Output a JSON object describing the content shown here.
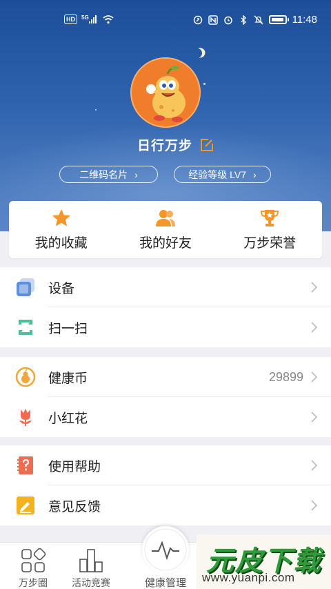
{
  "status_bar": {
    "time": "11:48",
    "network_label": "5G",
    "hd_label": "HD",
    "left_icons": [
      "hd-icon",
      "signal-icon",
      "wifi-icon"
    ],
    "right_icons": [
      "nfc-icon",
      "alarm-icon",
      "bluetooth-icon",
      "mute-icon",
      "battery-icon"
    ]
  },
  "profile": {
    "nickname": "日行万步",
    "qrcode_label": "二维码名片",
    "level_label": "经验等级 LV7"
  },
  "quick_actions": [
    {
      "label": "我的收藏",
      "icon": "star-icon"
    },
    {
      "label": "我的好友",
      "icon": "friends-icon"
    },
    {
      "label": "万步荣誉",
      "icon": "trophy-icon"
    }
  ],
  "menu_groups": [
    [
      {
        "label": "设备",
        "icon": "device-icon"
      },
      {
        "label": "扫一扫",
        "icon": "scan-icon"
      }
    ],
    [
      {
        "label": "健康币",
        "icon": "health-coin-icon",
        "value": "29899"
      },
      {
        "label": "小红花",
        "icon": "red-flower-icon"
      }
    ],
    [
      {
        "label": "使用帮助",
        "icon": "help-icon"
      },
      {
        "label": "意见反馈",
        "icon": "feedback-icon"
      }
    ]
  ],
  "tab_bar": {
    "tabs": [
      {
        "label": "万步圈",
        "icon": "circle-icon"
      },
      {
        "label": "活动竞赛",
        "icon": "activity-icon"
      },
      {
        "label": "健康管理",
        "icon": "pulse-icon"
      }
    ]
  },
  "watermark": {
    "brand": "元皮下载",
    "url": "www.yuanpi.com"
  },
  "colors": {
    "header_top": "#1c4e9a",
    "accent_orange": "#f5962b",
    "background": "#f0f0f4"
  }
}
